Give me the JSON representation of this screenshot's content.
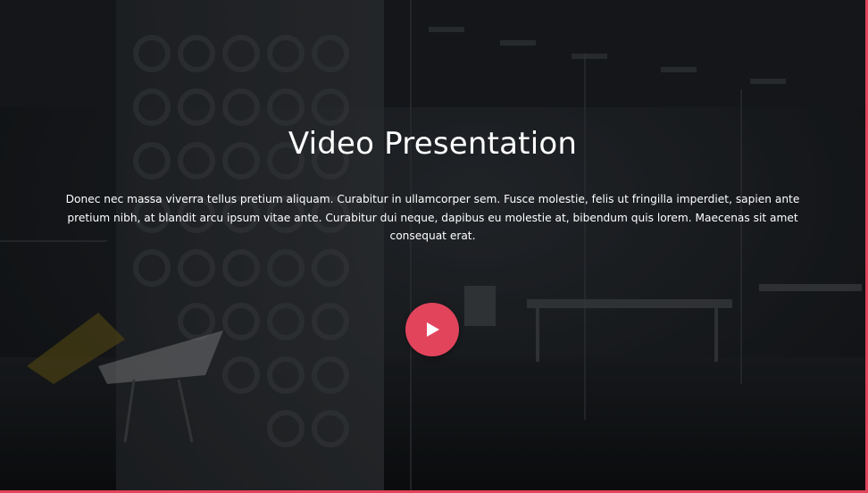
{
  "hero": {
    "title": "Video Presentation",
    "description": "Donec nec massa viverra tellus pretium aliquam. Curabitur in ullamcorper sem. Fusce molestie, felis ut fringilla imperdiet, sapien ante pretium nibh, at blandit arcu ipsum vitae ante. Curabitur dui neque, dapibus eu molestie at, bibendum quis lorem. Maecenas sit amet consequat erat.",
    "play_icon": "play-icon",
    "accent_color": "#e2445c",
    "background": "dark office interior photo"
  }
}
